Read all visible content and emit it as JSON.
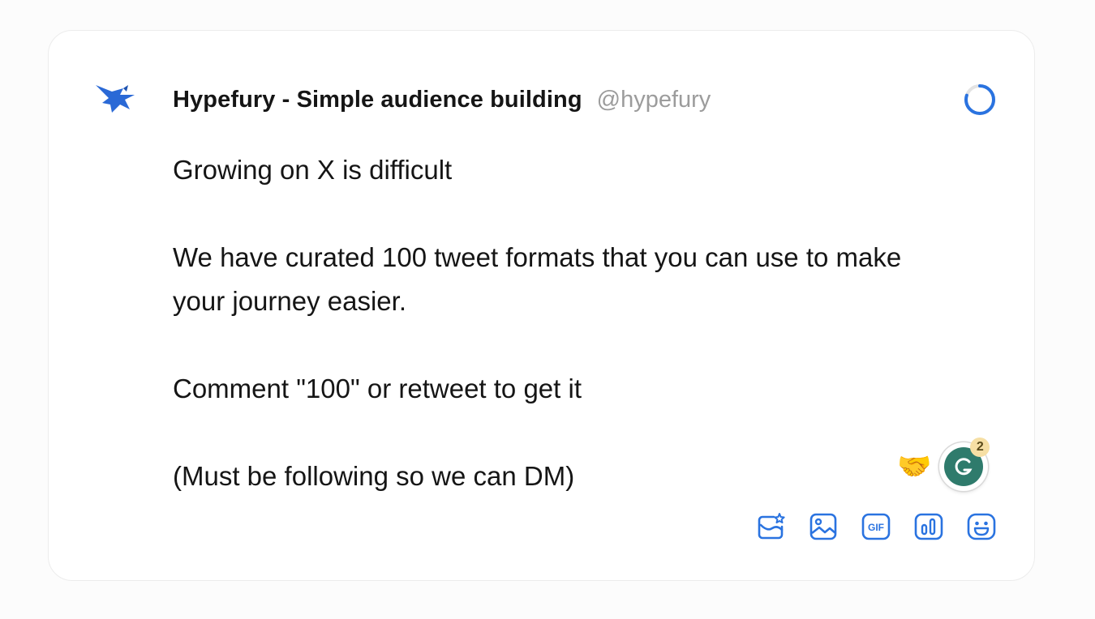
{
  "composer": {
    "author_name": "Hypefury - Simple audience building",
    "handle": "@hypefury",
    "paragraphs": [
      "Growing on X is difficult",
      "We have curated 100 tweet formats that you can use to make",
      "your journey easier.",
      "Comment \"100\" or retweet to get it",
      "(Must be following so we can DM)"
    ],
    "character_progress": 0.8,
    "reaction_emoji": "🤝",
    "grammarly_badge_count": "2",
    "toolbar_icons": [
      "image-sparkle-icon",
      "image-icon",
      "gif-icon",
      "poll-icon",
      "emoji-icon"
    ],
    "gif_label": "GIF"
  },
  "colors": {
    "accent": "#2a73e0",
    "avatar_bird": "#2a69d6",
    "grammarly": "#2f7b6c",
    "badge": "#f6dfa4",
    "text": "#151515",
    "handle": "#9c9c9c"
  }
}
